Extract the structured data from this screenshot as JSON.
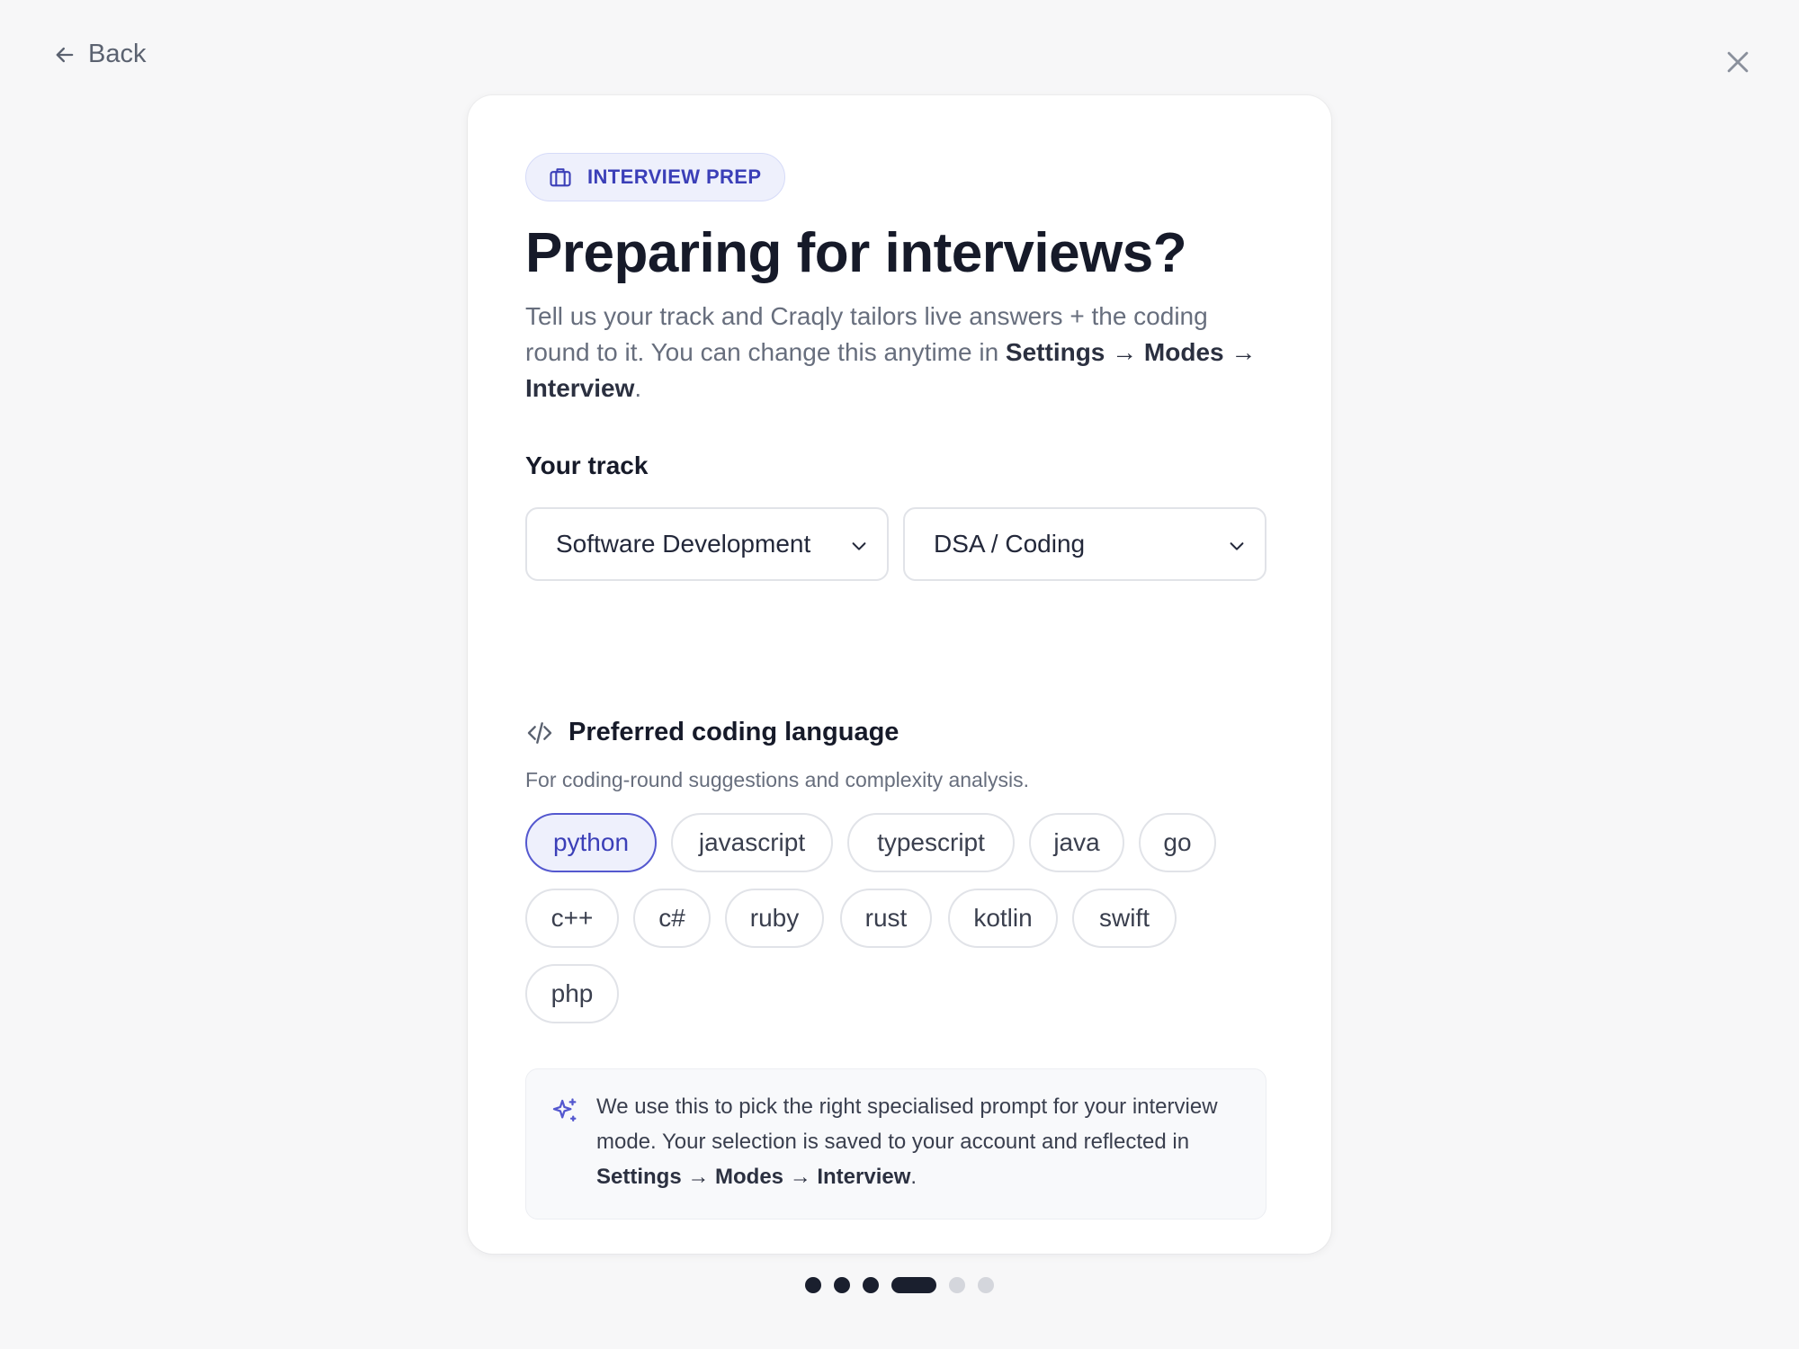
{
  "nav": {
    "back_label": "Back"
  },
  "badge": {
    "label": "INTERVIEW PREP",
    "icon": "briefcase-icon"
  },
  "heading": {
    "title": "Preparing for interviews?",
    "subtitle_part1": "Tell us your track and Craqly tailors live answers + the coding round to it. You can change this anytime in ",
    "subtitle_path": "Settings → Modes → Interview",
    "subtitle_end": "."
  },
  "track": {
    "label": "Your track",
    "primary_value": "Software Development",
    "secondary_value": "DSA / Coding"
  },
  "language": {
    "title": "Preferred coding language",
    "subtitle": "For coding-round suggestions and complexity analysis.",
    "selected": "python",
    "options": [
      "python",
      "javascript",
      "typescript",
      "java",
      "go",
      "c++",
      "c#",
      "ruby",
      "rust",
      "kotlin",
      "swift",
      "php"
    ]
  },
  "info": {
    "text_part1": "We use this to pick the right specialised prompt for your interview mode. Your selection is saved to your account and reflected in ",
    "text_path": "Settings → Modes → Interview",
    "text_end": ".",
    "icon": "sparkle-icon"
  },
  "progress": {
    "total_steps": 6,
    "current_step": 4
  },
  "colors": {
    "accent": "#3b3fb8",
    "accent_border": "#5458cf",
    "accent_bg": "#eef0fc",
    "dot_active": "#1a1f2e",
    "dot_inactive": "#d4d6dc"
  }
}
